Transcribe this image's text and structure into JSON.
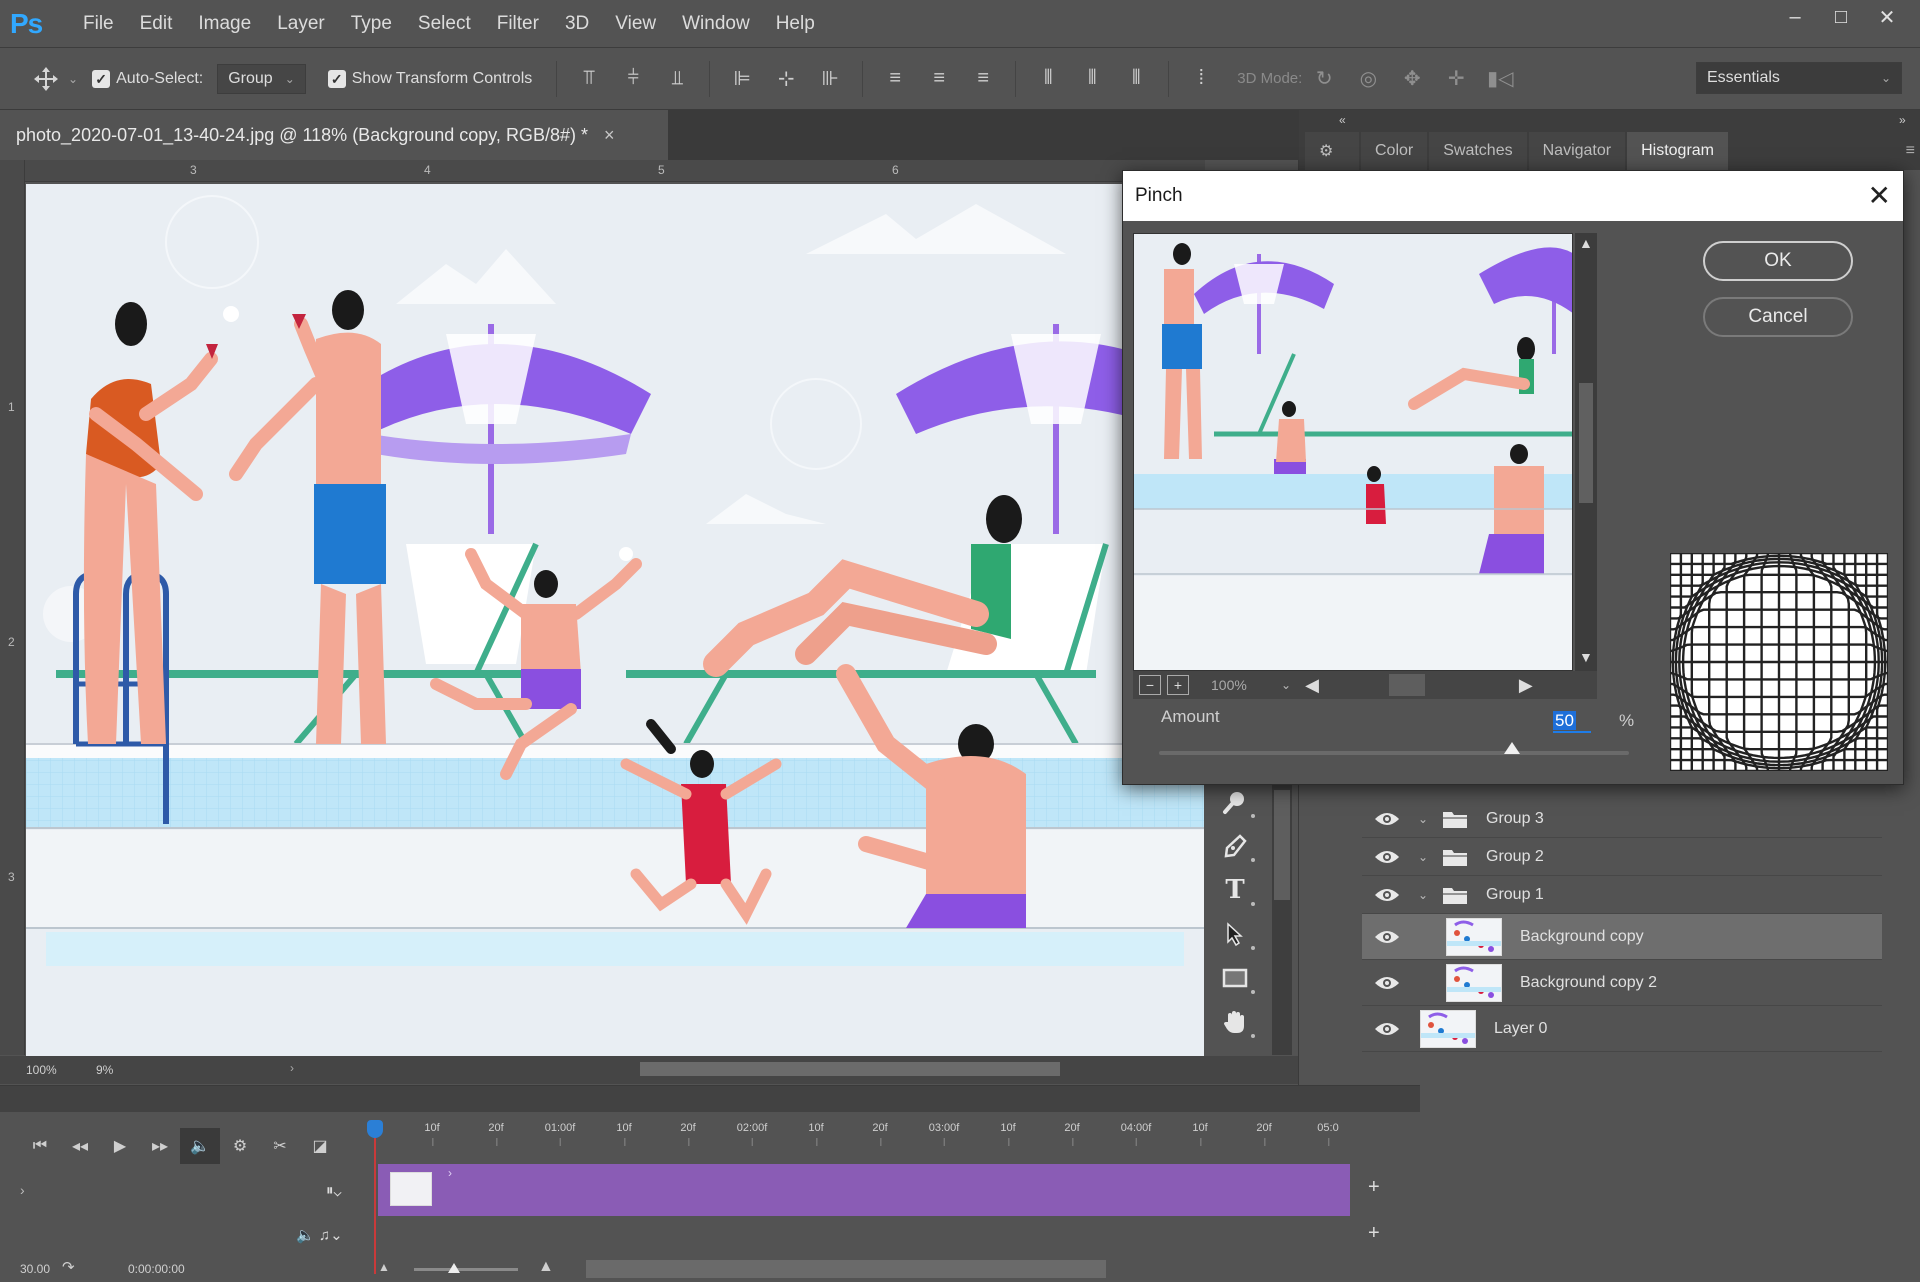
{
  "app": {
    "logo": "Ps",
    "menu": [
      "File",
      "Edit",
      "Image",
      "Layer",
      "Type",
      "Select",
      "Filter",
      "3D",
      "View",
      "Window",
      "Help"
    ],
    "window_controls": {
      "minimize": "–",
      "maximize": "□",
      "close": "✕"
    }
  },
  "options_bar": {
    "auto_select_label": "Auto-Select:",
    "auto_select_checked": true,
    "auto_select_mode": "Group",
    "show_transform_label": "Show Transform Controls",
    "show_transform_checked": true,
    "mode_3d_label": "3D Mode:",
    "workspace": "Essentials"
  },
  "document": {
    "tab_title": "photo_2020-07-01_13-40-24.jpg @ 118% (Background copy, RGB/8#) *",
    "close": "×",
    "ruler_top": [
      "3",
      "4",
      "5",
      "6"
    ],
    "ruler_left": [
      "1",
      "2",
      "3"
    ],
    "status_zoom": "100%",
    "status_info": "9%"
  },
  "panel_tabs": {
    "tabs": [
      "Color",
      "Swatches",
      "Navigator",
      "Histogram"
    ],
    "active": "Histogram",
    "collapse_left": "«",
    "collapse_right": "»"
  },
  "tools": [
    "zoom-tool",
    "pen-tool",
    "type-tool",
    "path-selection-tool",
    "rectangle-tool",
    "hand-tool"
  ],
  "tool_glyphs": {
    "type": "T"
  },
  "layers": [
    {
      "name": "Group 3",
      "kind": "group",
      "visible": true,
      "expanded": true
    },
    {
      "name": "Group 2",
      "kind": "group",
      "visible": true,
      "expanded": true
    },
    {
      "name": "Group 1",
      "kind": "group",
      "visible": true,
      "expanded": true
    },
    {
      "name": "Background copy",
      "kind": "layer",
      "visible": true,
      "selected": true
    },
    {
      "name": "Background copy 2",
      "kind": "layer",
      "visible": true
    },
    {
      "name": "Layer 0",
      "kind": "layer",
      "visible": true
    }
  ],
  "pinch_dialog": {
    "title": "Pinch",
    "close": "✕",
    "ok_label": "OK",
    "cancel_label": "Cancel",
    "preview_zoom": "100%",
    "zoom_out": "−",
    "zoom_in": "+",
    "amount_label": "Amount",
    "amount_value": "50",
    "amount_unit": "%",
    "amount_min": -100,
    "amount_max": 100
  },
  "timeline": {
    "ticks": [
      "10f",
      "20f",
      "01:00f",
      "10f",
      "20f",
      "02:00f",
      "10f",
      "20f",
      "03:00f",
      "10f",
      "20f",
      "04:00f",
      "10f",
      "20f",
      "05:0"
    ],
    "current_time": "0:00:00:00",
    "fps_label": "30.00",
    "track_color": "#8a5cb5"
  },
  "colors": {
    "accent": "#31a8ff",
    "selection": "#1e6fd9",
    "panel_bg": "#535353"
  }
}
